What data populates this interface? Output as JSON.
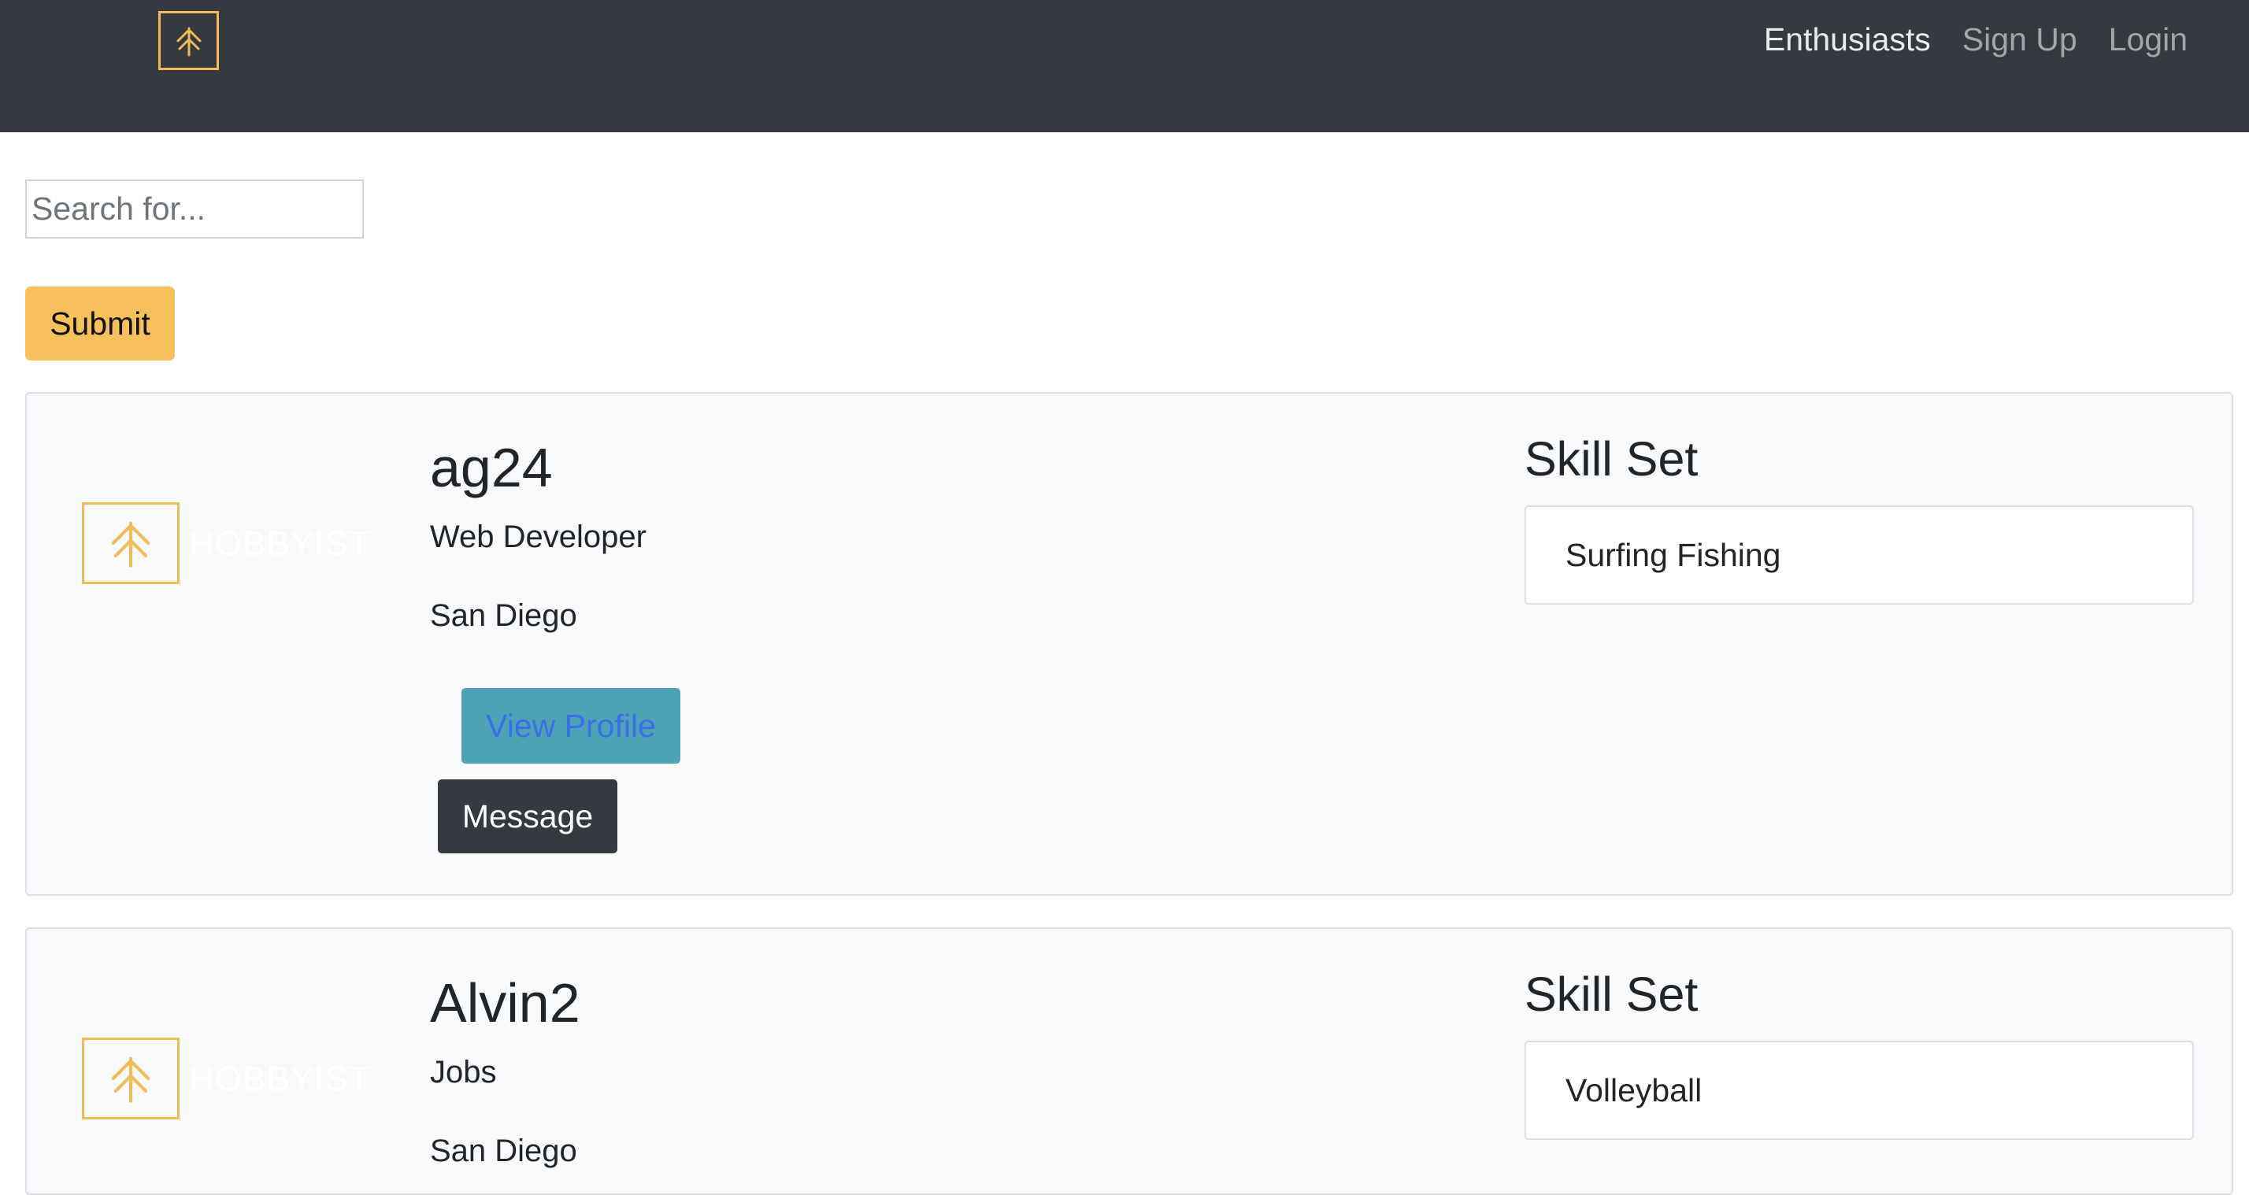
{
  "navbar": {
    "logo": "tree-logo-icon",
    "links": [
      {
        "label": "Enthusiasts",
        "active": true
      },
      {
        "label": "Sign Up",
        "active": false
      },
      {
        "label": "Login",
        "active": false
      }
    ]
  },
  "search": {
    "placeholder": "Search for...",
    "value": "",
    "submit_label": "Submit"
  },
  "colors": {
    "accent": "#f6c15d",
    "navbar": "#343a40",
    "info": "#4ea2b6",
    "card_bg": "#f8f9fa"
  },
  "cards": [
    {
      "brand_word": "HOBBYIST",
      "username": "ag24",
      "occupation": "Web Developer",
      "location": "San Diego",
      "view_label": "View Profile",
      "message_label": "Message",
      "skill_title": "Skill Set",
      "skills": "Surfing Fishing"
    },
    {
      "brand_word": "HOBBYIST",
      "username": "Alvin2",
      "occupation": "Jobs",
      "location": "San Diego",
      "skill_title": "Skill Set",
      "skills": "Volleyball"
    }
  ]
}
